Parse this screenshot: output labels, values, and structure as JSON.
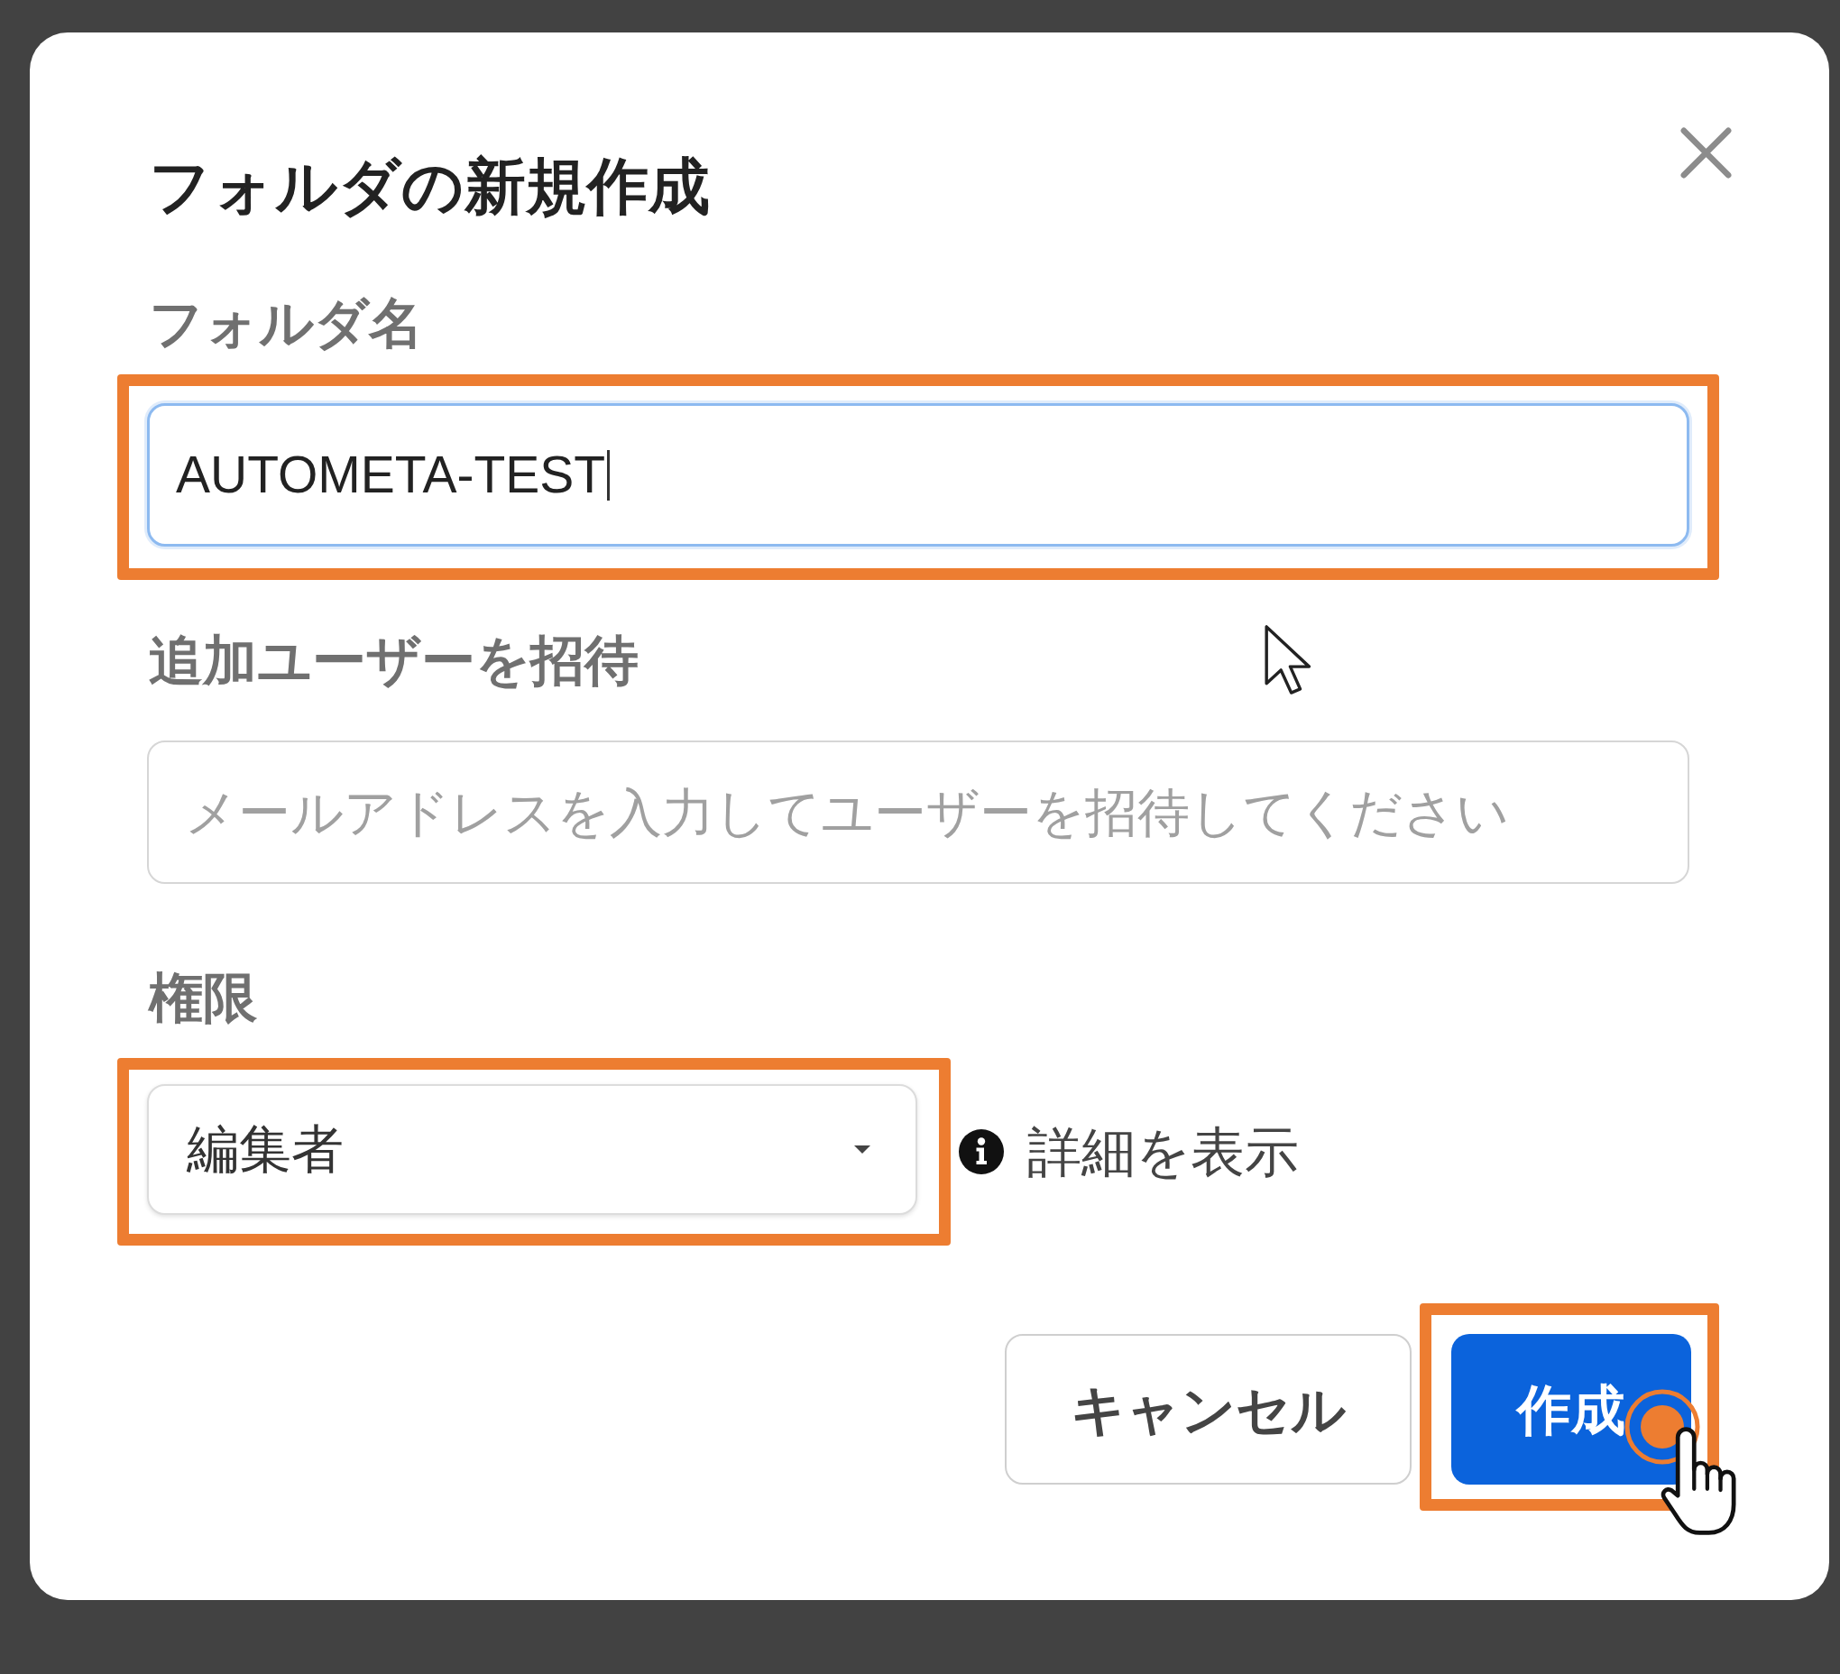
{
  "dialog": {
    "title": "フォルダの新規作成"
  },
  "fields": [
    {
      "kind": "text",
      "label": "フォルダ名",
      "value": "AUTOMETA-TEST",
      "focused": true,
      "highlighted": true
    },
    {
      "kind": "text",
      "label": "追加ユーザーを招待",
      "placeholder": "メールアドレスを入力してユーザーを招待してください",
      "focused": false,
      "highlighted": false
    },
    {
      "kind": "select",
      "label": "権限",
      "value": "編集者",
      "details_link": "詳細を表示",
      "highlighted": true
    }
  ],
  "buttons": [
    {
      "kind": "secondary",
      "label": "キャンセル",
      "highlighted": false,
      "clicked": false
    },
    {
      "kind": "primary",
      "label": "作成",
      "highlighted": true,
      "clicked": true
    }
  ]
}
